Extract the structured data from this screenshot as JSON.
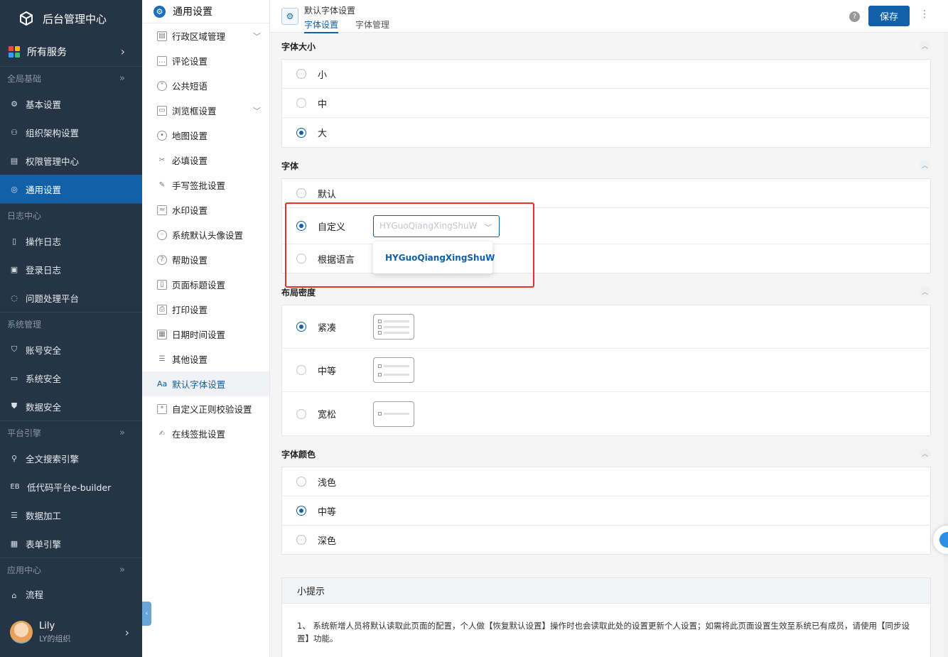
{
  "sidebar": {
    "brand": "后台管理中心",
    "all_services": "所有服务",
    "sections": [
      {
        "title": "全局基础",
        "items": [
          "基本设置",
          "组织架构设置",
          "权限管理中心",
          "通用设置"
        ]
      },
      {
        "title": "日志中心",
        "items": [
          "操作日志",
          "登录日志",
          "问题处理平台"
        ]
      },
      {
        "title": "系统管理",
        "items": [
          "账号安全",
          "系统安全",
          "数据安全"
        ]
      },
      {
        "title": "平台引擎",
        "items": [
          "全文搜索引擎",
          "低代码平台e-builder",
          "数据加工",
          "表单引擎"
        ]
      },
      {
        "title": "应用中心",
        "items": [
          "流程"
        ]
      }
    ],
    "eb_prefix": "EB",
    "user": {
      "name": "Lily",
      "org": "LY的组织"
    }
  },
  "submenu": {
    "header": "通用设置",
    "items": [
      "行政区域管理",
      "评论设置",
      "公共短语",
      "浏览框设置",
      "地图设置",
      "必填设置",
      "手写签批设置",
      "水印设置",
      "系统默认头像设置",
      "帮助设置",
      "页面标题设置",
      "打印设置",
      "日期时间设置",
      "其他设置",
      "默认字体设置",
      "自定义正则校验设置",
      "在线签批设置"
    ],
    "active_prefix": "Aa"
  },
  "topbar": {
    "title": "默认字体设置",
    "tabs": [
      "字体设置",
      "字体管理"
    ],
    "help": "?",
    "save": "保存"
  },
  "groups": {
    "size": {
      "title": "字体大小",
      "options": [
        "小",
        "中",
        "大"
      ],
      "selected": 2
    },
    "font": {
      "title": "字体",
      "options": [
        "默认",
        "自定义",
        "根据语言"
      ],
      "selected": 1,
      "select_value": "HYGuoQiangXingShuW",
      "dropdown_option": "HYGuoQiangXingShuW"
    },
    "density": {
      "title": "布局密度",
      "options": [
        "紧凑",
        "中等",
        "宽松"
      ],
      "selected": 0
    },
    "color": {
      "title": "字体颜色",
      "options": [
        "浅色",
        "中等",
        "深色"
      ],
      "selected": 1
    }
  },
  "tips": {
    "title": "小提示",
    "text": "1、 系统新增人员将默认读取此页面的配置，个人做【恢复默认设置】操作时也会读取此处的设置更新个人设置；如需将此页面设置生效至系统已有成员，请使用【同步设置】功能。"
  },
  "colors": {
    "primary": "#1160a8",
    "sidebar_bg": "#253545",
    "highlight_box": "#e8302a"
  }
}
